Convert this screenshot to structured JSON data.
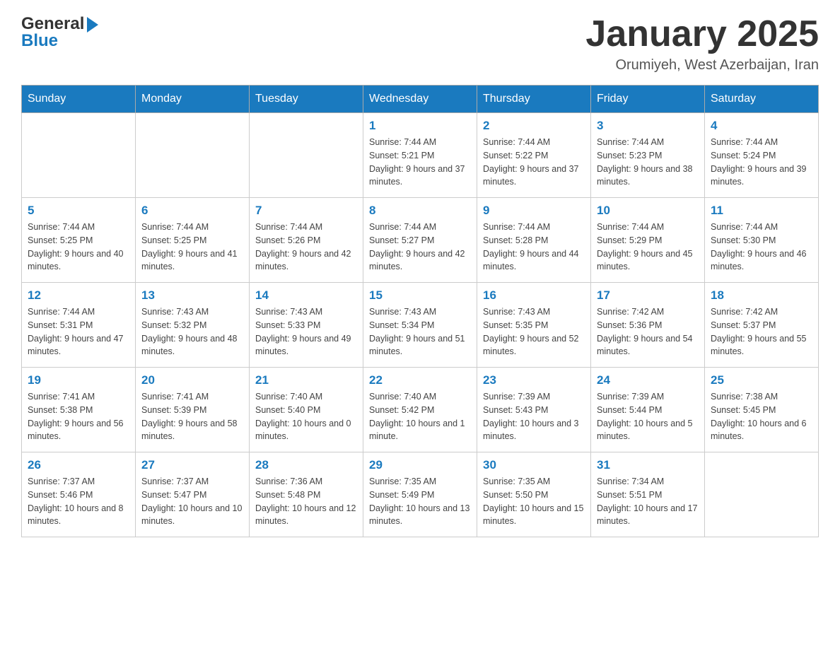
{
  "header": {
    "logo_text_general": "General",
    "logo_text_blue": "Blue",
    "month_title": "January 2025",
    "location": "Orumiyeh, West Azerbaijan, Iran"
  },
  "days_of_week": [
    "Sunday",
    "Monday",
    "Tuesday",
    "Wednesday",
    "Thursday",
    "Friday",
    "Saturday"
  ],
  "weeks": [
    [
      {
        "day": "",
        "info": ""
      },
      {
        "day": "",
        "info": ""
      },
      {
        "day": "",
        "info": ""
      },
      {
        "day": "1",
        "info": "Sunrise: 7:44 AM\nSunset: 5:21 PM\nDaylight: 9 hours and 37 minutes."
      },
      {
        "day": "2",
        "info": "Sunrise: 7:44 AM\nSunset: 5:22 PM\nDaylight: 9 hours and 37 minutes."
      },
      {
        "day": "3",
        "info": "Sunrise: 7:44 AM\nSunset: 5:23 PM\nDaylight: 9 hours and 38 minutes."
      },
      {
        "day": "4",
        "info": "Sunrise: 7:44 AM\nSunset: 5:24 PM\nDaylight: 9 hours and 39 minutes."
      }
    ],
    [
      {
        "day": "5",
        "info": "Sunrise: 7:44 AM\nSunset: 5:25 PM\nDaylight: 9 hours and 40 minutes."
      },
      {
        "day": "6",
        "info": "Sunrise: 7:44 AM\nSunset: 5:25 PM\nDaylight: 9 hours and 41 minutes."
      },
      {
        "day": "7",
        "info": "Sunrise: 7:44 AM\nSunset: 5:26 PM\nDaylight: 9 hours and 42 minutes."
      },
      {
        "day": "8",
        "info": "Sunrise: 7:44 AM\nSunset: 5:27 PM\nDaylight: 9 hours and 42 minutes."
      },
      {
        "day": "9",
        "info": "Sunrise: 7:44 AM\nSunset: 5:28 PM\nDaylight: 9 hours and 44 minutes."
      },
      {
        "day": "10",
        "info": "Sunrise: 7:44 AM\nSunset: 5:29 PM\nDaylight: 9 hours and 45 minutes."
      },
      {
        "day": "11",
        "info": "Sunrise: 7:44 AM\nSunset: 5:30 PM\nDaylight: 9 hours and 46 minutes."
      }
    ],
    [
      {
        "day": "12",
        "info": "Sunrise: 7:44 AM\nSunset: 5:31 PM\nDaylight: 9 hours and 47 minutes."
      },
      {
        "day": "13",
        "info": "Sunrise: 7:43 AM\nSunset: 5:32 PM\nDaylight: 9 hours and 48 minutes."
      },
      {
        "day": "14",
        "info": "Sunrise: 7:43 AM\nSunset: 5:33 PM\nDaylight: 9 hours and 49 minutes."
      },
      {
        "day": "15",
        "info": "Sunrise: 7:43 AM\nSunset: 5:34 PM\nDaylight: 9 hours and 51 minutes."
      },
      {
        "day": "16",
        "info": "Sunrise: 7:43 AM\nSunset: 5:35 PM\nDaylight: 9 hours and 52 minutes."
      },
      {
        "day": "17",
        "info": "Sunrise: 7:42 AM\nSunset: 5:36 PM\nDaylight: 9 hours and 54 minutes."
      },
      {
        "day": "18",
        "info": "Sunrise: 7:42 AM\nSunset: 5:37 PM\nDaylight: 9 hours and 55 minutes."
      }
    ],
    [
      {
        "day": "19",
        "info": "Sunrise: 7:41 AM\nSunset: 5:38 PM\nDaylight: 9 hours and 56 minutes."
      },
      {
        "day": "20",
        "info": "Sunrise: 7:41 AM\nSunset: 5:39 PM\nDaylight: 9 hours and 58 minutes."
      },
      {
        "day": "21",
        "info": "Sunrise: 7:40 AM\nSunset: 5:40 PM\nDaylight: 10 hours and 0 minutes."
      },
      {
        "day": "22",
        "info": "Sunrise: 7:40 AM\nSunset: 5:42 PM\nDaylight: 10 hours and 1 minute."
      },
      {
        "day": "23",
        "info": "Sunrise: 7:39 AM\nSunset: 5:43 PM\nDaylight: 10 hours and 3 minutes."
      },
      {
        "day": "24",
        "info": "Sunrise: 7:39 AM\nSunset: 5:44 PM\nDaylight: 10 hours and 5 minutes."
      },
      {
        "day": "25",
        "info": "Sunrise: 7:38 AM\nSunset: 5:45 PM\nDaylight: 10 hours and 6 minutes."
      }
    ],
    [
      {
        "day": "26",
        "info": "Sunrise: 7:37 AM\nSunset: 5:46 PM\nDaylight: 10 hours and 8 minutes."
      },
      {
        "day": "27",
        "info": "Sunrise: 7:37 AM\nSunset: 5:47 PM\nDaylight: 10 hours and 10 minutes."
      },
      {
        "day": "28",
        "info": "Sunrise: 7:36 AM\nSunset: 5:48 PM\nDaylight: 10 hours and 12 minutes."
      },
      {
        "day": "29",
        "info": "Sunrise: 7:35 AM\nSunset: 5:49 PM\nDaylight: 10 hours and 13 minutes."
      },
      {
        "day": "30",
        "info": "Sunrise: 7:35 AM\nSunset: 5:50 PM\nDaylight: 10 hours and 15 minutes."
      },
      {
        "day": "31",
        "info": "Sunrise: 7:34 AM\nSunset: 5:51 PM\nDaylight: 10 hours and 17 minutes."
      },
      {
        "day": "",
        "info": ""
      }
    ]
  ]
}
